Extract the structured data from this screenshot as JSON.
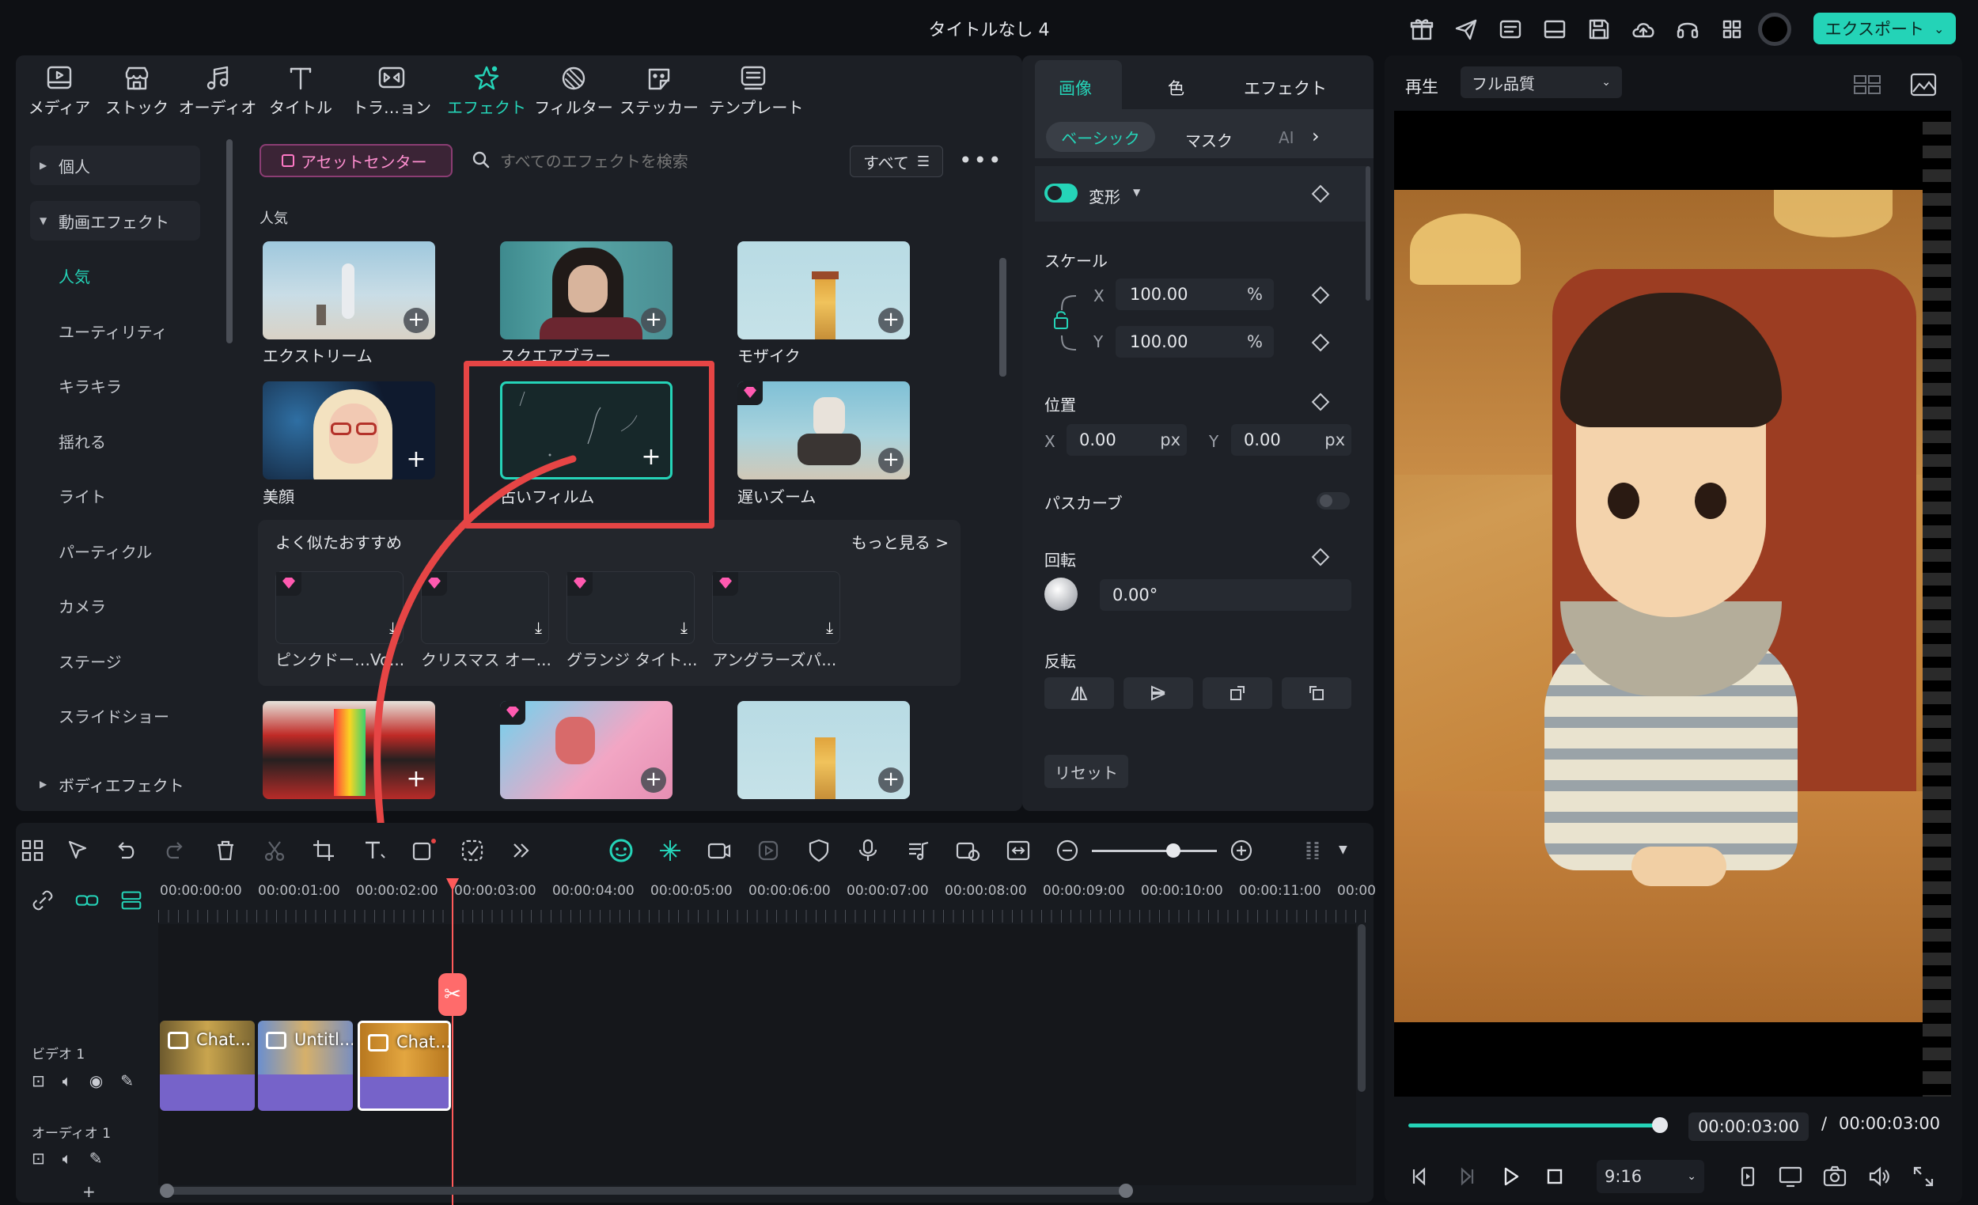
{
  "app": {
    "title": "タイトルなし 4",
    "export_label": "エクスポート",
    "accent": "#25d4b8"
  },
  "toolbar": {
    "tabs": [
      {
        "label": "メディア",
        "icon": "media-icon"
      },
      {
        "label": "ストック",
        "icon": "stock-icon"
      },
      {
        "label": "オーディオ",
        "icon": "audio-icon"
      },
      {
        "label": "タイトル",
        "icon": "title-icon"
      },
      {
        "label": "トラ…ョン",
        "icon": "transition-icon"
      },
      {
        "label": "エフェクト",
        "icon": "effect-icon",
        "active": true
      },
      {
        "label": "フィルター",
        "icon": "filter-icon"
      },
      {
        "label": "ステッカー",
        "icon": "sticker-icon"
      },
      {
        "label": "テンプレート",
        "icon": "template-icon"
      }
    ]
  },
  "sidebar": {
    "items": [
      {
        "label": "個人",
        "type": "section",
        "expanded": false
      },
      {
        "label": "動画エフェクト",
        "type": "section",
        "expanded": true
      },
      {
        "label": "人気",
        "type": "sub",
        "active": true
      },
      {
        "label": "ユーティリティ",
        "type": "sub"
      },
      {
        "label": "キラキラ",
        "type": "sub"
      },
      {
        "label": "揺れる",
        "type": "sub"
      },
      {
        "label": "ライト",
        "type": "sub"
      },
      {
        "label": "パーティクル",
        "type": "sub"
      },
      {
        "label": "カメラ",
        "type": "sub"
      },
      {
        "label": "ステージ",
        "type": "sub"
      },
      {
        "label": "スライドショー",
        "type": "sub"
      },
      {
        "label": "ボディエフェクト",
        "type": "section",
        "expanded": false
      }
    ]
  },
  "effects": {
    "asset_center": "アセットセンター",
    "search_placeholder": "すべてのエフェクトを検索",
    "filter_label": "すべて",
    "section_title": "人気",
    "tiles": [
      {
        "label": "エクストリーム"
      },
      {
        "label": "スクエアブラー"
      },
      {
        "label": "モザイク"
      },
      {
        "label": "美顔"
      },
      {
        "label": "古いフィルム",
        "selected": true
      },
      {
        "label": "遅いズーム",
        "premium": true
      }
    ],
    "recommend": {
      "title": "よく似たおすすめ",
      "more": "もっと見る >",
      "items": [
        {
          "label": "ピンクドー…Vo..."
        },
        {
          "label": "クリスマス オー..."
        },
        {
          "label": "グランジ タイト..."
        },
        {
          "label": "アングラーズパ..."
        }
      ]
    }
  },
  "properties": {
    "tabs": [
      "画像",
      "色",
      "エフェクト"
    ],
    "subtabs": [
      "ベーシック",
      "マスク",
      "AI"
    ],
    "transform_label": "変形",
    "scale_label": "スケール",
    "scale_x": "100.00",
    "scale_y": "100.00",
    "percent": "%",
    "x_label": "X",
    "y_label": "Y",
    "position_label": "位置",
    "pos_x": "0.00",
    "pos_y": "0.00",
    "px": "px",
    "path_curve_label": "パスカーブ",
    "rotation_label": "回転",
    "rotation_value": "0.00°",
    "flip_label": "反転",
    "reset_label": "リセット"
  },
  "player": {
    "play_label": "再生",
    "quality": "フル品質",
    "current_time": "00:00:03:00",
    "separator": "/",
    "total_time": "00:00:03:00",
    "aspect": "9:16",
    "progress": 1.0
  },
  "timeline": {
    "ruler": [
      "00:00:00:00",
      "00:00:01:00",
      "00:00:02:00",
      "00:00:03:00",
      "00:00:04:00",
      "00:00:05:00",
      "00:00:06:00",
      "00:00:07:00",
      "00:00:08:00",
      "00:00:09:00",
      "00:00:10:00",
      "00:00:11:00",
      "00:00"
    ],
    "video_track": "ビデオ 1",
    "audio_track": "オーディオ 1",
    "clips": [
      {
        "label": "Chat..."
      },
      {
        "label": "Untitl..."
      },
      {
        "label": "Chat..."
      }
    ],
    "add_track": "+"
  }
}
